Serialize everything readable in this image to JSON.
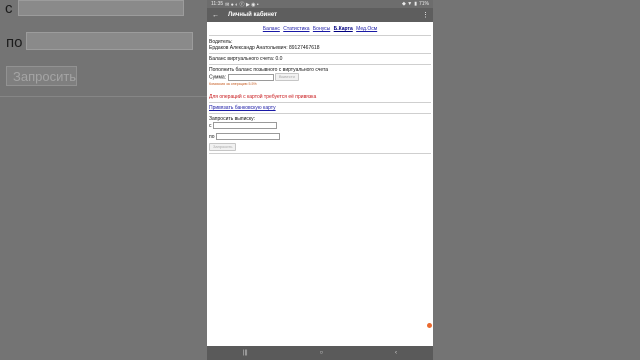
{
  "background": {
    "from_label": "с",
    "to_label": "по",
    "request_button": "Запросить"
  },
  "statusbar": {
    "time": "11:35",
    "battery": "71%"
  },
  "appbar": {
    "back_icon": "arrow-left-icon",
    "title": "Личный кабинет",
    "more_icon": "more-vert-icon"
  },
  "tabs": [
    {
      "label": "Баланс"
    },
    {
      "label": "Статистика"
    },
    {
      "label": "Бонусы"
    },
    {
      "label": "Б.Карта"
    },
    {
      "label": "Мед.Осм"
    }
  ],
  "driver": {
    "label": "Водитель:",
    "value": "Ердаков Александр Анатольевич: 89127467618"
  },
  "virtual_balance": {
    "label": "Баланс виртуального счета:",
    "value": "0.0"
  },
  "topup": {
    "heading": "Пополнить баланс позывного с виртуального счета",
    "amount_label": "Сумма:",
    "button": "Вывести",
    "commission": "Комиссия за операцию 5.5%"
  },
  "card": {
    "warning": "Для операций с картой требуется её привязка",
    "link": "Привязать банковскую карту"
  },
  "statement": {
    "heading": "Запросить выписку:",
    "from_label": "с",
    "to_label": "по",
    "button": "Запросить"
  },
  "colors": {
    "accent": "#1a1aa6",
    "warning": "#c8181b",
    "hint": "#c65a1e",
    "fab": "#ea6a2f"
  }
}
